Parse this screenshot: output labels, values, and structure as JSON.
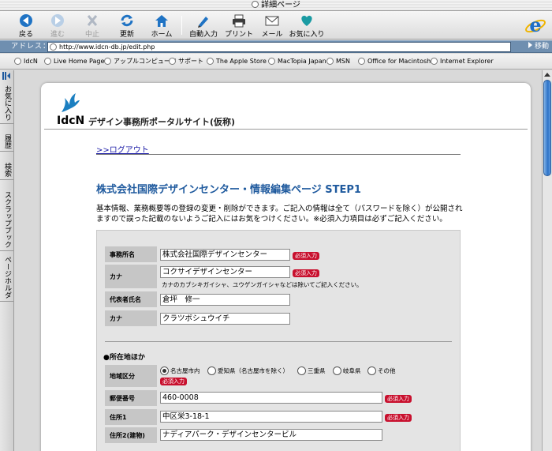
{
  "window": {
    "title": "詳細ページ"
  },
  "toolbar": {
    "buttons": [
      {
        "label": "戻る",
        "icon": "back-arrow-icon",
        "enabled": true
      },
      {
        "label": "進む",
        "icon": "forward-arrow-icon",
        "enabled": false
      },
      {
        "label": "中止",
        "icon": "stop-icon",
        "enabled": false
      },
      {
        "label": "更新",
        "icon": "refresh-icon",
        "enabled": true
      },
      {
        "label": "ホーム",
        "icon": "home-icon",
        "enabled": true
      },
      {
        "label": "自動入力",
        "icon": "autofill-icon",
        "enabled": true
      },
      {
        "label": "プリント",
        "icon": "printer-icon",
        "enabled": true
      },
      {
        "label": "メール",
        "icon": "mail-icon",
        "enabled": true
      },
      {
        "label": "お気に入り",
        "icon": "heart-icon",
        "enabled": true
      }
    ]
  },
  "address": {
    "label": "アドレス：",
    "url": "http://www.idcn-db.jp/edit.php",
    "go_label": "移動"
  },
  "favorites": [
    "IdcN",
    "Live Home Page",
    "アップルコンピュータ",
    "サポート",
    "The Apple Store",
    "MacTopia Japan",
    "MSN",
    "Office for Macintosh",
    "Internet Explorer"
  ],
  "side_tabs": [
    "お気に入り",
    "履歴",
    "検索",
    "スクラップブック",
    "ページホルダ"
  ],
  "page": {
    "logo_text": "IdcN",
    "site_title": "デザイン事務所ポータルサイト(仮称)",
    "logout_link": ">>ログアウト",
    "heading": "株式会社国際デザインセンター・情報編集ページ STEP1",
    "intro": "基本情報、業務概要等の登録の変更・削除ができます。ご記入の情報は全て（パスワードを除く）が公開されますので誤った記載のないようご記入にはお気をつけください。※必須入力項目は必ずご記入ください。"
  },
  "form": {
    "required_badge": "必須入力",
    "office_name": {
      "label": "事務所名",
      "value": "株式会社国際デザインセンター"
    },
    "kana": {
      "label": "カナ",
      "value": "コクサイデザインセンター",
      "note": "カナのカブシキガイシャ、ユウゲンガイシャなどは除いてご記入ください。"
    },
    "representative": {
      "label": "代表者氏名",
      "value": "倉坪　修一"
    },
    "rep_kana": {
      "label": "カナ",
      "value": "クラツボシュウイチ"
    },
    "location_section": "●所在地ほか",
    "region": {
      "label": "地域区分",
      "options": [
        "名古屋市内",
        "愛知県（名古屋市を除く）",
        "三重県",
        "岐阜県",
        "その他"
      ],
      "selected": "名古屋市内"
    },
    "postal": {
      "label": "郵便番号",
      "value": "460-0008"
    },
    "address1": {
      "label": "住所1",
      "value": "中区栄3-18-1"
    },
    "address2": {
      "label": "住所2(建物)",
      "value": "ナディアパーク・デザインセンタービル"
    }
  },
  "colors": {
    "heading": "#1f5a9e",
    "required": "#c8102e",
    "link": "#1a1aa6",
    "address_bar": "#6f8fb0"
  }
}
